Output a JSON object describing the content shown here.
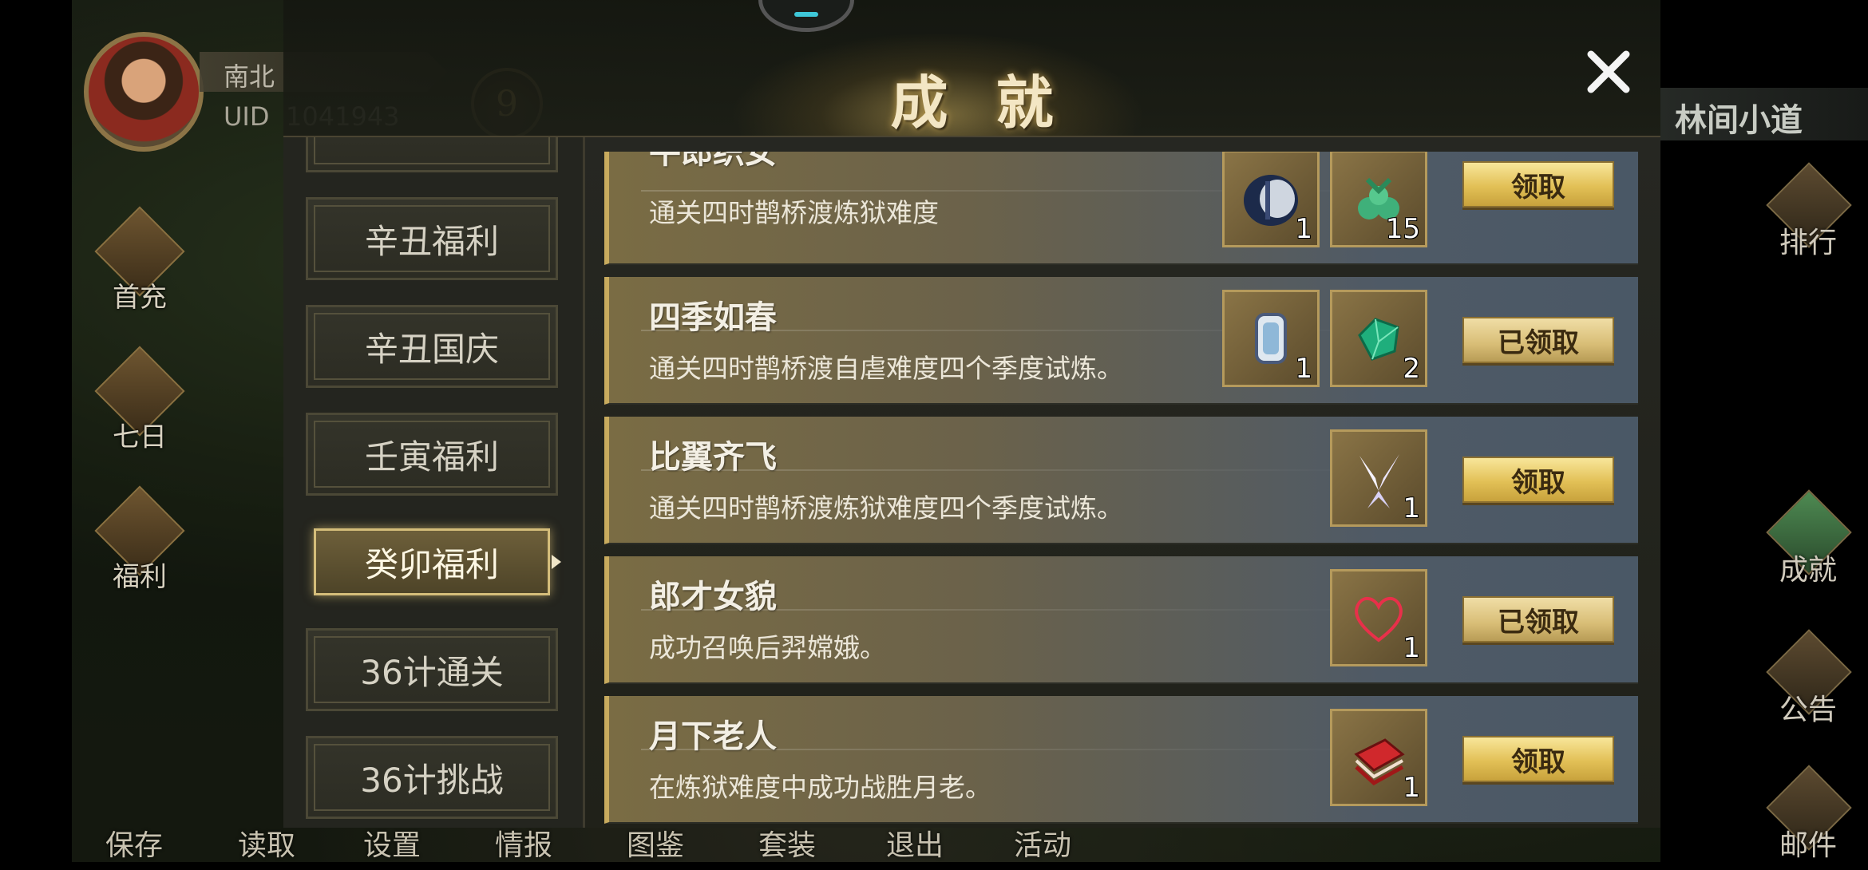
{
  "player": {
    "name": "南北",
    "uid_label": "UID",
    "uid": "1041943",
    "level": "9"
  },
  "left_menu": [
    {
      "label": "首充",
      "icon": "gift-box-icon"
    },
    {
      "label": "七日",
      "icon": "scroll-icon"
    },
    {
      "label": "福利",
      "icon": "treasure-icon"
    }
  ],
  "bottom_menu": [
    "保存",
    "读取",
    "设置",
    "情报",
    "图鉴",
    "套装",
    "退出",
    "活动"
  ],
  "location": "林间小道",
  "right_menu": [
    {
      "label": "排行",
      "icon": "ranking-tower-icon"
    },
    {
      "label": "成就",
      "icon": "jade-trophy-icon"
    },
    {
      "label": "公告",
      "icon": "horn-icon"
    },
    {
      "label": "邮件",
      "icon": "mail-icon"
    }
  ],
  "dialog": {
    "title": "成就",
    "categories": [
      "辛丑福利",
      "辛丑国庆",
      "壬寅福利",
      "癸卯福利",
      "36计通关",
      "36计挑战"
    ],
    "active_category": "癸卯福利",
    "achievements": [
      {
        "title": "牛郎织女",
        "desc": "通关四时鹊桥渡炼狱难度",
        "rewards": [
          {
            "icon": "armor-helmet-icon",
            "count": "1"
          },
          {
            "icon": "green-herb-icon",
            "count": "15"
          }
        ],
        "button": "领取",
        "claimed": false
      },
      {
        "title": "四季如春",
        "desc": "通关四时鹊桥渡自虐难度四个季度试炼。",
        "rewards": [
          {
            "icon": "crystal-token-icon",
            "count": "1"
          },
          {
            "icon": "emerald-gem-icon",
            "count": "2"
          }
        ],
        "button": "已领取",
        "claimed": true
      },
      {
        "title": "比翼齐飞",
        "desc": "通关四时鹊桥渡炼狱难度四个季度试炼。",
        "rewards": [
          {
            "icon": "wings-icon",
            "count": "1"
          }
        ],
        "button": "领取",
        "claimed": false
      },
      {
        "title": "郎才女貌",
        "desc": "成功召唤后羿嫦娥。",
        "rewards": [
          {
            "icon": "heart-icon",
            "count": "1"
          }
        ],
        "button": "已领取",
        "claimed": true
      },
      {
        "title": "月下老人",
        "desc": "在炼狱难度中成功战胜月老。",
        "rewards": [
          {
            "icon": "red-book-icon",
            "count": "1"
          }
        ],
        "button": "领取",
        "claimed": false
      }
    ]
  },
  "colors": {
    "accent_gold": "#e2c056",
    "item_gold": "#7a6c44",
    "item_steel": "#4a5866"
  }
}
